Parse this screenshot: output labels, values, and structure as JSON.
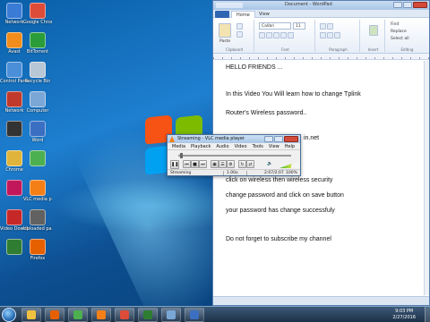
{
  "desktop": {
    "icons": [
      {
        "label": "Network",
        "color": "#3a7bd5"
      },
      {
        "label": "Google Chrome",
        "color": "#dd4b39"
      },
      {
        "label": "Avast",
        "color": "#f28c1a"
      },
      {
        "label": "BitTorrent",
        "color": "#2a9d3a"
      },
      {
        "label": "Control Panel",
        "color": "#4a8fd8"
      },
      {
        "label": "Recycle Bin",
        "color": "#b8c7d6"
      },
      {
        "label": "Network",
        "color": "#c0392b"
      },
      {
        "label": "Computer",
        "color": "#7aa7d6"
      },
      {
        "label": "",
        "color": "#333333"
      },
      {
        "label": "Word",
        "color": "#3b6fc2"
      },
      {
        "label": "Chrome",
        "color": "#e0b43a"
      },
      {
        "label": "",
        "color": "#4caf50"
      },
      {
        "label": "",
        "color": "#c2185b"
      },
      {
        "label": "VLC media player",
        "color": "#f57f17"
      },
      {
        "label": "Video Downloader",
        "color": "#c62828"
      },
      {
        "label": "Uploaded password",
        "color": "#616161"
      },
      {
        "label": "",
        "color": "#2e7d32"
      },
      {
        "label": "Firefox",
        "color": "#e66000"
      }
    ]
  },
  "wordpad": {
    "title": "Document - WordPad",
    "tabs": [
      "Home",
      "View"
    ],
    "ribbon": {
      "clipboard": "Clipboard",
      "paste": "Paste",
      "font_name": "Calibri",
      "font_size": "11",
      "font": "Font",
      "paragraph": "Paragraph",
      "insert": "Insert",
      "find": "Find",
      "replace": "Replace",
      "select_all": "Select all",
      "editing": "Editing"
    },
    "lines": [
      "HELLO FRIENDS ...",
      "In this Video You Will learn how to change Tplink",
      "Router's Wireless password..",
      "in.net",
      "click on wireless  then wireless security",
      "change password and  click on save button",
      "your password has change successfuly",
      "Do not forget to subscribe my channel"
    ]
  },
  "vlc": {
    "title": "Streaming - VLC media player",
    "menu": [
      "Media",
      "Playback",
      "Audio",
      "Video",
      "Tools",
      "View",
      "Help"
    ],
    "status_text": "Streaming",
    "time": "2:07/2:07",
    "volume_percent": "100%",
    "volume_level": 1.0
  },
  "taskbar": {
    "time": "9:03 PM",
    "date": "2/27/2016",
    "pinned": [
      {
        "name": "explorer",
        "color": "#f0c040"
      },
      {
        "name": "firefox",
        "color": "#e66000"
      },
      {
        "name": "media",
        "color": "#4caf50"
      },
      {
        "name": "vlc",
        "color": "#f57f17"
      },
      {
        "name": "chrome",
        "color": "#dd4b39"
      },
      {
        "name": "camtasia",
        "color": "#2e7d32"
      },
      {
        "name": "network",
        "color": "#7aa7d6"
      },
      {
        "name": "wordpad",
        "color": "#3b6fc2"
      }
    ]
  }
}
